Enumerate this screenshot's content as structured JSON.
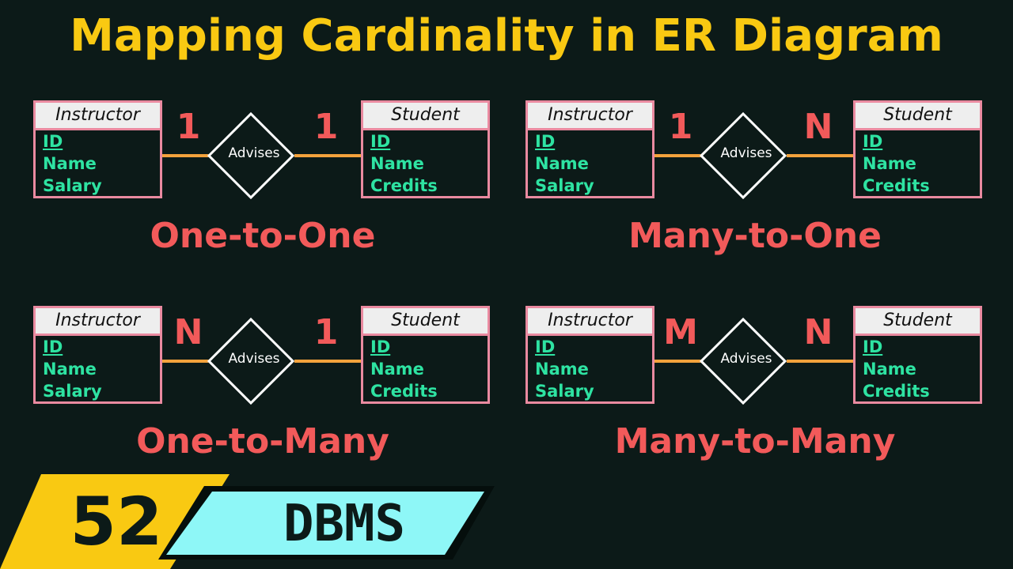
{
  "title": "Mapping Cardinality in ER Diagram",
  "diagrams": [
    {
      "left_entity": {
        "name": "Instructor",
        "attributes": [
          "ID",
          "Name",
          "Salary"
        ]
      },
      "right_entity": {
        "name": "Student",
        "attributes": [
          "ID",
          "Name",
          "Credits"
        ]
      },
      "relationship": "Advises",
      "left_cardinality": "1",
      "right_cardinality": "1",
      "caption": "One-to-One"
    },
    {
      "left_entity": {
        "name": "Instructor",
        "attributes": [
          "ID",
          "Name",
          "Salary"
        ]
      },
      "right_entity": {
        "name": "Student",
        "attributes": [
          "ID",
          "Name",
          "Credits"
        ]
      },
      "relationship": "Advises",
      "left_cardinality": "1",
      "right_cardinality": "N",
      "caption": "Many-to-One"
    },
    {
      "left_entity": {
        "name": "Instructor",
        "attributes": [
          "ID",
          "Name",
          "Salary"
        ]
      },
      "right_entity": {
        "name": "Student",
        "attributes": [
          "ID",
          "Name",
          "Credits"
        ]
      },
      "relationship": "Advises",
      "left_cardinality": "N",
      "right_cardinality": "1",
      "caption": "One-to-Many"
    },
    {
      "left_entity": {
        "name": "Instructor",
        "attributes": [
          "ID",
          "Name",
          "Salary"
        ]
      },
      "right_entity": {
        "name": "Student",
        "attributes": [
          "ID",
          "Name",
          "Credits"
        ]
      },
      "relationship": "Advises",
      "left_cardinality": "M",
      "right_cardinality": "N",
      "caption": "Many-to-Many"
    }
  ],
  "badge": {
    "number": "52",
    "subject": "DBMS"
  },
  "colors": {
    "background": "#0c1a18",
    "title": "#f9c912",
    "accent_red": "#f25a5a",
    "attribute_green": "#2ee3a2",
    "entity_border": "#ea8aa0",
    "line": "#f4a23c",
    "badge_yellow": "#f9c912",
    "badge_cyan": "#8ef7f7"
  }
}
